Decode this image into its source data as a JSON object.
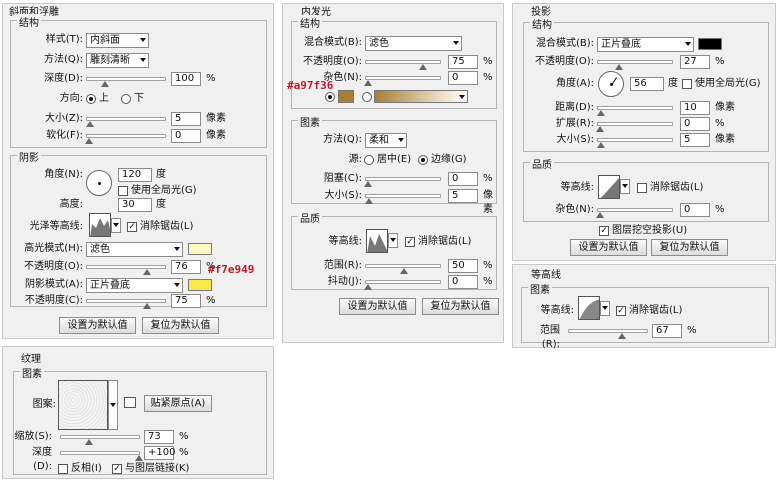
{
  "bevel": {
    "title": "斜面和浮雕",
    "structure": "结构",
    "style_label": "样式(T):",
    "style_value": "内斜面",
    "method_label": "方法(Q):",
    "method_value": "雕刻清晰",
    "depth_label": "深度(D):",
    "depth_value": "100",
    "depth_unit": "%",
    "dir_label": "方向:",
    "dir_up": "上",
    "dir_down": "下",
    "size_label": "大小(Z):",
    "size_value": "5",
    "size_unit": "像素",
    "soften_label": "软化(F):",
    "soften_value": "0",
    "soften_unit": "像素",
    "shading": "阴影",
    "angle_label": "角度(N):",
    "angle_value": "120",
    "angle_unit": "度",
    "global_light": "使用全局光(G)",
    "altitude_label": "高度:",
    "altitude_value": "30",
    "altitude_unit": "度",
    "gloss_label": "光泽等高线:",
    "antialias": "消除锯齿(L)",
    "hl_mode_label": "高光模式(H):",
    "hl_mode_value": "滤色",
    "hl_opacity_label": "不透明度(O):",
    "hl_opacity_value": "76",
    "sh_mode_label": "阴影模式(A):",
    "sh_mode_value": "正片叠底",
    "sh_opacity_label": "不透明度(C):",
    "sh_opacity_value": "75",
    "pct": "%",
    "reset_default": "设置为默认值",
    "restore_default": "复位为默认值",
    "hl_color": "#fff9c4",
    "sh_color": "#f7e949",
    "sh_color_note": "#f7e949"
  },
  "inner_glow": {
    "title": "内发光",
    "structure": "结构",
    "blend_label": "混合模式(B):",
    "blend_value": "滤色",
    "opacity_label": "不透明度(O):",
    "opacity_value": "75",
    "noise_label": "杂色(N):",
    "noise_value": "0",
    "pct": "%",
    "color_note": "#a97f36",
    "color": "#a97f36",
    "elements": "图素",
    "method_label": "方法(Q):",
    "method_value": "柔和",
    "source_label": "源:",
    "source_center": "居中(E)",
    "source_edge": "边缘(G)",
    "choke_label": "阻塞(C):",
    "choke_value": "0",
    "size_label": "大小(S):",
    "size_value": "5",
    "size_unit": "像素",
    "quality": "品质",
    "contour_label": "等高线:",
    "antialias": "消除锯齿(L)",
    "range_label": "范围(R):",
    "range_value": "50",
    "jitter_label": "抖动(J):",
    "jitter_value": "0",
    "reset_default": "设置为默认值",
    "restore_default": "复位为默认值"
  },
  "drop_shadow": {
    "title": "投影",
    "structure": "结构",
    "blend_label": "混合模式(B):",
    "blend_value": "正片叠底",
    "opacity_label": "不透明度(O):",
    "opacity_value": "27",
    "pct": "%",
    "angle_label": "角度(A):",
    "angle_value": "56",
    "angle_unit": "度",
    "global_light": "使用全局光(G)",
    "distance_label": "距离(D):",
    "distance_value": "10",
    "spread_label": "扩展(R):",
    "spread_value": "0",
    "size_label": "大小(S):",
    "size_value": "5",
    "px": "像素",
    "quality": "品质",
    "contour_label": "等高线:",
    "antialias": "消除锯齿(L)",
    "noise_label": "杂色(N):",
    "noise_value": "0",
    "knockout": "图层挖空投影(U)",
    "reset_default": "设置为默认值",
    "restore_default": "复位为默认值",
    "color": "#000000"
  },
  "contour": {
    "title": "等高线",
    "elements": "图素",
    "contour_label": "等高线:",
    "antialias": "消除锯齿(L)",
    "range_label": "范围(R):",
    "range_value": "67",
    "pct": "%"
  },
  "texture": {
    "title": "纹理",
    "elements": "图素",
    "pattern_label": "图案:",
    "snap_origin": "贴紧原点(A)",
    "scale_label": "缩放(S):",
    "scale_value": "73",
    "depth_label": "深度(D):",
    "depth_value": "+100",
    "pct": "%",
    "invert": "反相(I)",
    "link_layer": "与图层链接(K)"
  }
}
